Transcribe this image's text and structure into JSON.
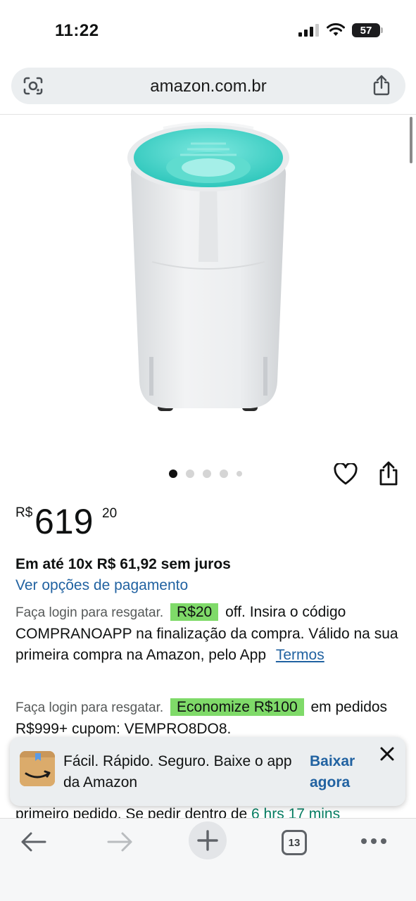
{
  "status_bar": {
    "time": "11:22",
    "battery": "57"
  },
  "browser": {
    "url": "amazon.com.br",
    "tab_count": "13"
  },
  "carousel": {
    "total_images": 5,
    "active_index": 0
  },
  "price": {
    "currency": "R$",
    "whole": "619",
    "fraction": "20"
  },
  "installments": "Em até 10x R$ 61,92 sem juros",
  "payment_link": "Ver opções de pagamento",
  "promo1": {
    "lead": "Faça login para resgatar.",
    "badge": "R$20",
    "text": "off. Insira o código COMPRANOAPP na finalização da compra. Válido na sua primeira compra na Amazon, pelo App",
    "link": "Termos"
  },
  "promo2": {
    "lead": "Faça login para resgatar.",
    "badge": "Economize R$100",
    "text": "em pedidos R$999+ cupom: VEMPRO8DO8."
  },
  "partial_line": {
    "text": "primeiro pedido. Se pedir dentro de",
    "highlight": "6 hrs 17 mins"
  },
  "app_banner": {
    "text": "Fácil. Rápido. Seguro. Baixe o app da Amazon",
    "link": "Baixar agora"
  },
  "colors": {
    "link": "#2162a1",
    "badge": "#7fda69",
    "accent_teal": "#3fd3c9"
  }
}
